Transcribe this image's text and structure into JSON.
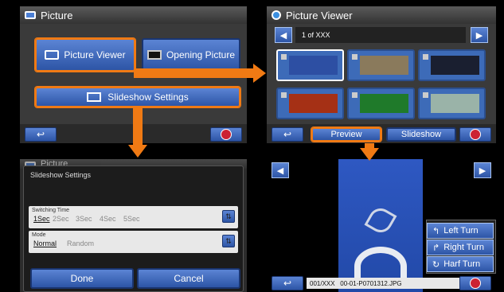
{
  "picture_menu": {
    "title": "Picture",
    "picture_viewer_label": "Picture Viewer",
    "opening_picture_label": "Opening Picture",
    "slideshow_settings_label": "Slideshow Settings",
    "back_icon": "↩",
    "nav_icon": "navigation-icon"
  },
  "viewer": {
    "title": "Picture Viewer",
    "page_label": "1 of XXX",
    "prev_icon": "◀",
    "next_icon": "▶",
    "preview_label": "Preview",
    "slideshow_label": "Slideshow",
    "back_icon": "↩"
  },
  "slideshow_settings": {
    "background_title": "Picture",
    "dialog_title": "Slideshow Settings",
    "switching_time_label": "Switching Time",
    "switching_options": [
      "1Sec",
      "2Sec",
      "3Sec",
      "4Sec",
      "5Sec"
    ],
    "mode_label": "Mode",
    "mode_options": [
      "Normal",
      "Random"
    ],
    "spin_icon": "⇅",
    "done_label": "Done",
    "cancel_label": "Cancel"
  },
  "preview": {
    "prev_icon": "◀",
    "next_icon": "▶",
    "left_turn_label": "Left Turn",
    "right_turn_label": "Right Turn",
    "half_turn_label": "Harf Turn",
    "left_turn_icon": "↰",
    "right_turn_icon": "↱",
    "half_turn_icon": "↻",
    "file_info": "001/XXX   00-01-P0701312.JPG",
    "back_icon": "↩"
  },
  "colors": {
    "accent_orange": "#f07a14",
    "button_blue": "#3d6bb8"
  }
}
